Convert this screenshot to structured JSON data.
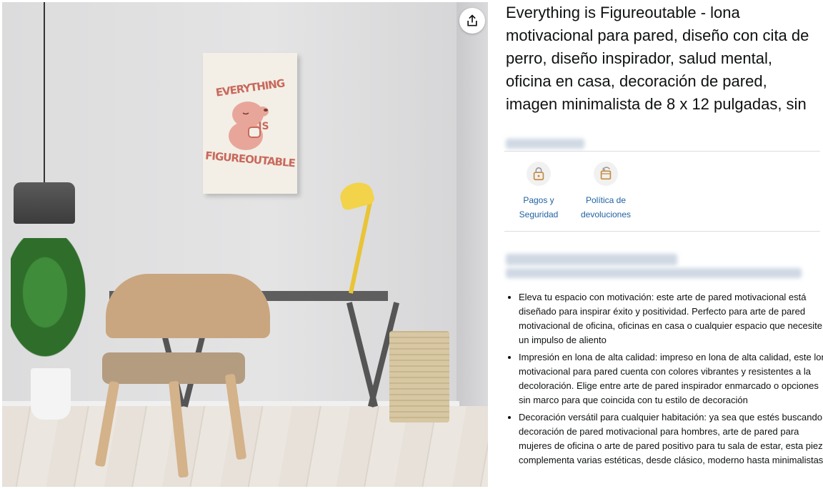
{
  "product": {
    "title": "Everything is Figureoutable - lona motivacional para pared, diseño con cita de perro, diseño inspirador, salud mental, oficina en casa, decoración de pared, imagen minimalista de 8 x 12 pulgadas, sin",
    "image": {
      "art_top_text": "EVERYTHING",
      "art_middle_text": "IS",
      "art_bottom_text": "FIGUREOUTABLE"
    }
  },
  "badges": [
    {
      "label_line1": "Pagos y",
      "label_line2": "Seguridad",
      "icon": "lock-icon"
    },
    {
      "label_line1": "Política de",
      "label_line2": "devoluciones",
      "icon": "return-box-icon"
    }
  ],
  "bullets": [
    "Eleva tu espacio con motivación: este arte de pared motivacional está diseñado para inspirar éxito y positividad. Perfecto para arte de pared motivacional de oficina, oficinas en casa o cualquier espacio que necesite un impulso de aliento",
    "Impresión en lona de alta calidad: impreso en lona de alta calidad, este lona motivacional para pared cuenta con colores vibrantes y resistentes a la decoloración. Elige entre arte de pared inspirador enmarcado o opciones sin marco para que coincida con tu estilo de decoración",
    "Decoración versátil para cualquier habitación: ya sea que estés buscando decoración de pared motivacional para hombres, arte de pared para mujeres de oficina o arte de pared positivo para tu sala de estar, esta pieza complementa varias estéticas, desde clásico, moderno hasta minimalistas"
  ],
  "colors": {
    "link": "#2162a1",
    "art_text": "#c9695d"
  }
}
